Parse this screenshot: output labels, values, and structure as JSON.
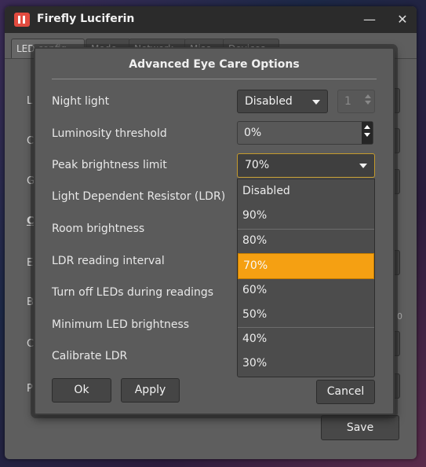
{
  "window": {
    "title": "Firefly Luciferin",
    "minimize_glyph": "—",
    "close_glyph": "✕"
  },
  "tabs": [
    {
      "label": "LED config"
    },
    {
      "label": "Mode"
    },
    {
      "label": "Network"
    },
    {
      "label": "Misc"
    },
    {
      "label": "Devices"
    }
  ],
  "background": {
    "labels": [
      "L",
      "C",
      "G",
      "C",
      "E",
      "B",
      "C",
      "P"
    ],
    "slider_end": "0",
    "save_label": "Save"
  },
  "dialog": {
    "title": "Advanced Eye Care Options",
    "rows": [
      {
        "label": "Night light"
      },
      {
        "label": "Luminosity threshold"
      },
      {
        "label": "Peak brightness limit"
      },
      {
        "label": "Light Dependent Resistor (LDR)"
      },
      {
        "label": "Room brightness"
      },
      {
        "label": "LDR reading interval"
      },
      {
        "label": "Turn off LEDs during readings"
      },
      {
        "label": "Minimum LED brightness"
      },
      {
        "label": "Calibrate LDR"
      }
    ],
    "night_light": {
      "value": "Disabled",
      "spinner_value": "1"
    },
    "luminosity_threshold": {
      "value": "0%"
    },
    "peak_brightness": {
      "value": "70%",
      "options": [
        "Disabled",
        "90%",
        "80%",
        "70%",
        "60%",
        "50%",
        "40%",
        "30%"
      ],
      "selected_index": 3
    },
    "buttons": {
      "ok": "Ok",
      "apply": "Apply",
      "cancel": "Cancel"
    }
  },
  "colors": {
    "selection": "#f5a012",
    "focus_border": "#c49a2c",
    "app_icon": "#e24b3f"
  }
}
